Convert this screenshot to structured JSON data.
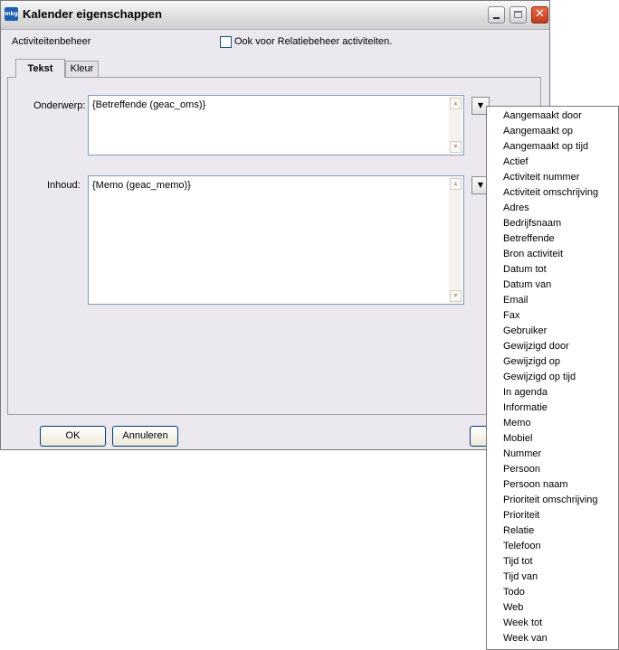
{
  "window": {
    "title": "Kalender eigenschappen",
    "logo_text": "mkg"
  },
  "header": {
    "section_label": "Activiteitenbeheer",
    "checkbox_label": "Ook voor Relatiebeheer activiteiten.",
    "checkbox_checked": false
  },
  "tabs": [
    {
      "label": "Tekst",
      "active": true
    },
    {
      "label": "Kleur",
      "active": false
    }
  ],
  "fields": {
    "onderwerp_label": "Onderwerp:",
    "onderwerp_value": "{Betreffende (geac_oms)}",
    "inhoud_label": "Inhoud:",
    "inhoud_value": "{Memo (geac_memo)}"
  },
  "buttons": {
    "ok": "OK",
    "cancel": "Annuleren"
  },
  "field_menu": {
    "items": [
      "Aangemaakt door",
      "Aangemaakt op",
      "Aangemaakt op tijd",
      "Actief",
      "Activiteit nummer",
      "Activiteit omschrijving",
      "Adres",
      "Bedrijfsnaam",
      "Betreffende",
      "Bron activiteit",
      "Datum tot",
      "Datum van",
      "Email",
      "Fax",
      "Gebruiker",
      "Gewijzigd door",
      "Gewijzigd op",
      "Gewijzigd op tijd",
      "In agenda",
      "Informatie",
      "Memo",
      "Mobiel",
      "Nummer",
      "Persoon",
      "Persoon naam",
      "Prioriteit omschrijving",
      "Prioriteit",
      "Relatie",
      "Telefoon",
      "Tijd tot",
      "Tijd van",
      "Todo",
      "Web",
      "Week tot",
      "Week van"
    ]
  }
}
